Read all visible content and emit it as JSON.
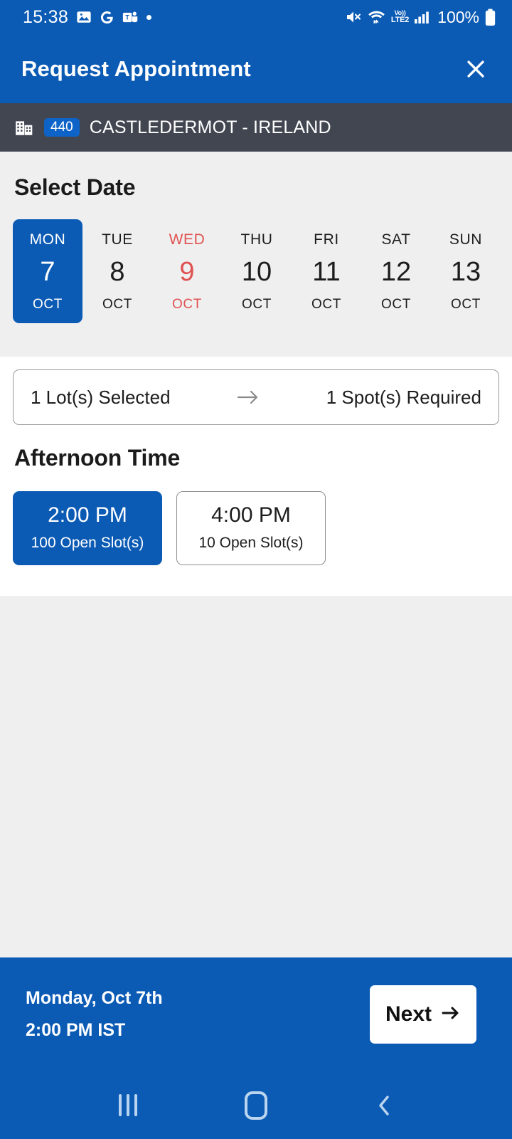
{
  "status_bar": {
    "time": "15:38",
    "battery": "100%",
    "network_label_top": "Vo))",
    "network_label_bottom": "LTE2",
    "icons": [
      "gallery-icon",
      "google-icon",
      "teams-icon",
      "dot-icon",
      "mute-icon",
      "wifi-icon",
      "volte-icon",
      "signal-icon",
      "battery-icon"
    ]
  },
  "header": {
    "title": "Request Appointment",
    "close_label": "×"
  },
  "location": {
    "badge": "440",
    "name": "CASTLEDERMOT - IRELAND"
  },
  "date_section": {
    "title": "Select Date",
    "days": [
      {
        "dow": "MON",
        "day": "7",
        "month": "OCT",
        "state": "selected"
      },
      {
        "dow": "TUE",
        "day": "8",
        "month": "OCT",
        "state": "normal"
      },
      {
        "dow": "WED",
        "day": "9",
        "month": "OCT",
        "state": "holiday"
      },
      {
        "dow": "THU",
        "day": "10",
        "month": "OCT",
        "state": "normal"
      },
      {
        "dow": "FRI",
        "day": "11",
        "month": "OCT",
        "state": "normal"
      },
      {
        "dow": "SAT",
        "day": "12",
        "month": "OCT",
        "state": "normal"
      },
      {
        "dow": "SUN",
        "day": "13",
        "month": "OCT",
        "state": "normal"
      }
    ]
  },
  "lot_summary": {
    "left": "1 Lot(s) Selected",
    "right": "1 Spot(s) Required"
  },
  "time_section": {
    "title": "Afternoon Time",
    "slots": [
      {
        "time": "2:00 PM",
        "slots": "100 Open Slot(s)",
        "state": "selected"
      },
      {
        "time": "4:00 PM",
        "slots": "10 Open Slot(s)",
        "state": "normal"
      }
    ]
  },
  "footer": {
    "date_line": "Monday, Oct 7th",
    "time_line": "2:00 PM IST",
    "next_label": "Next"
  },
  "nav_bar": {
    "recents": "recents-button",
    "home": "home-button",
    "back": "back-button"
  },
  "colors": {
    "brand_blue": "#0B5BB5",
    "badge_blue": "#0E63C8",
    "dark_slate": "#414650",
    "holiday_red": "#e05252",
    "section_gray": "#efefef"
  }
}
